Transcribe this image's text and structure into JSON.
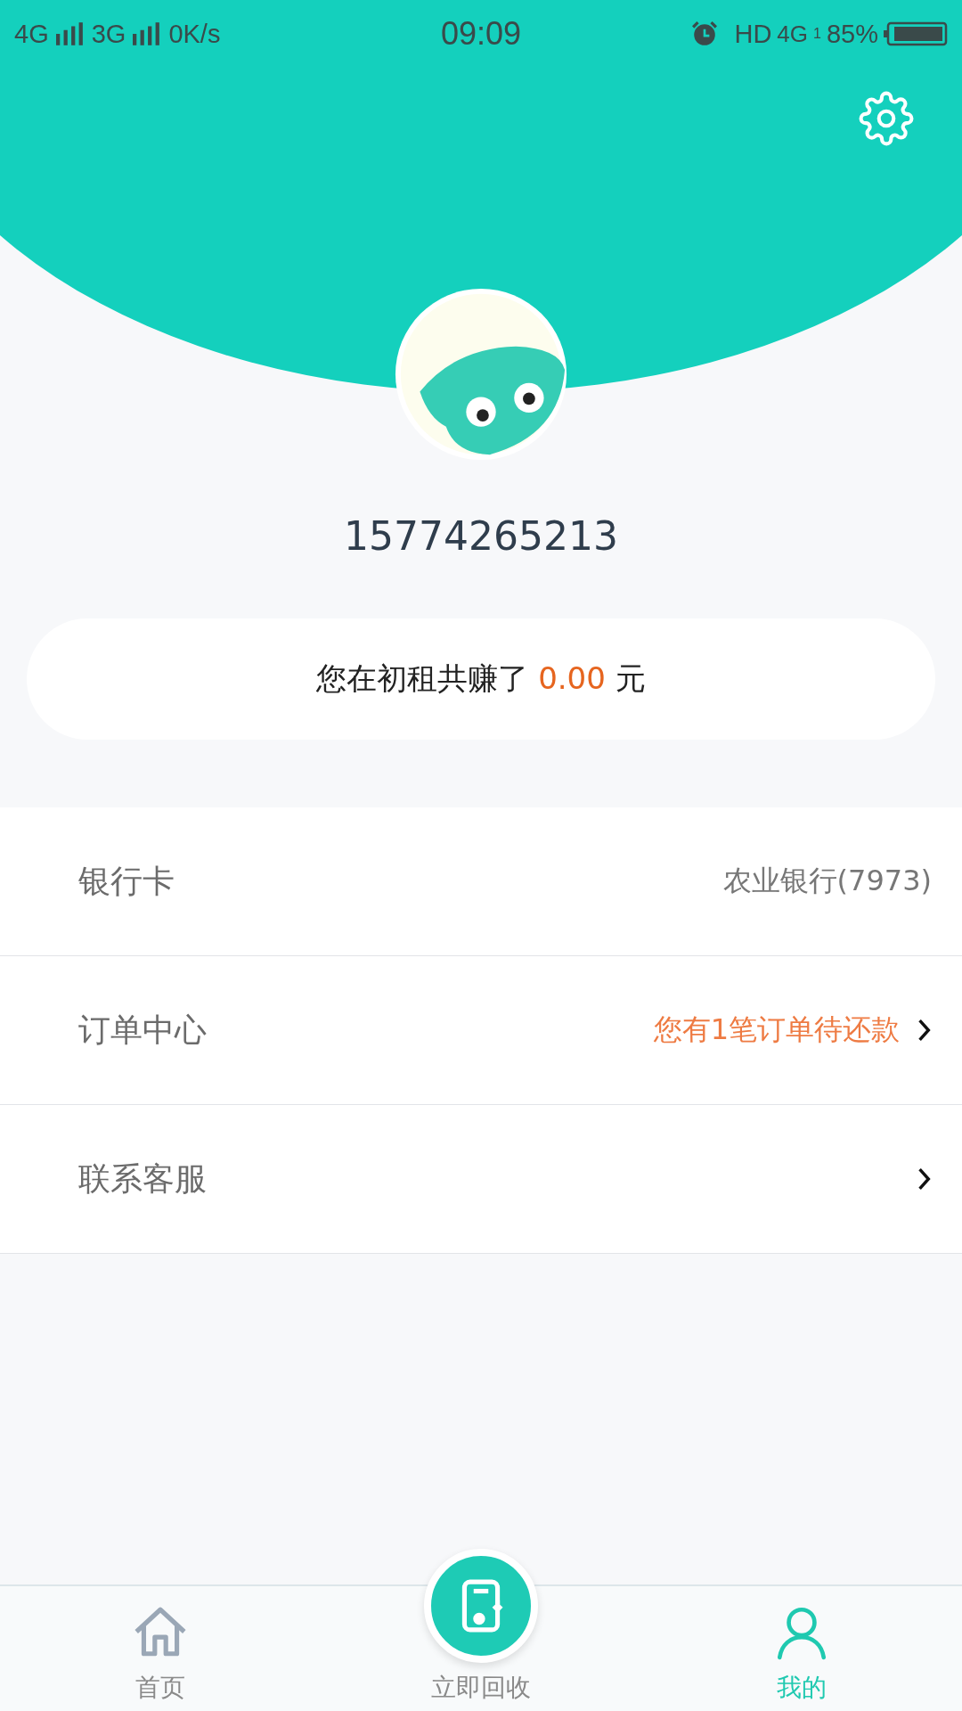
{
  "status_bar": {
    "network_1": "4G",
    "network_2": "3G",
    "speed": "0K/s",
    "time": "09:09",
    "hd": "HD",
    "mobile": "4G",
    "sim": "1",
    "battery": "85%"
  },
  "profile": {
    "phone": "15774265213"
  },
  "earnings": {
    "prefix": "您在初租共赚了",
    "amount": "0.00",
    "unit": "元"
  },
  "menu": [
    {
      "label": "银行卡",
      "value": "农业银行(7973)",
      "kind": "plain",
      "has_arrow": false
    },
    {
      "label": "订单中心",
      "value": "您有1笔订单待还款",
      "kind": "alert",
      "has_arrow": true
    },
    {
      "label": "联系客服",
      "has_arrow": true
    }
  ],
  "tabs": [
    {
      "label": "首页",
      "kind": "home",
      "selected": false
    },
    {
      "label": "立即回收",
      "kind": "recycle",
      "selected": false
    },
    {
      "label": "我的",
      "kind": "profile",
      "selected": true
    }
  ]
}
